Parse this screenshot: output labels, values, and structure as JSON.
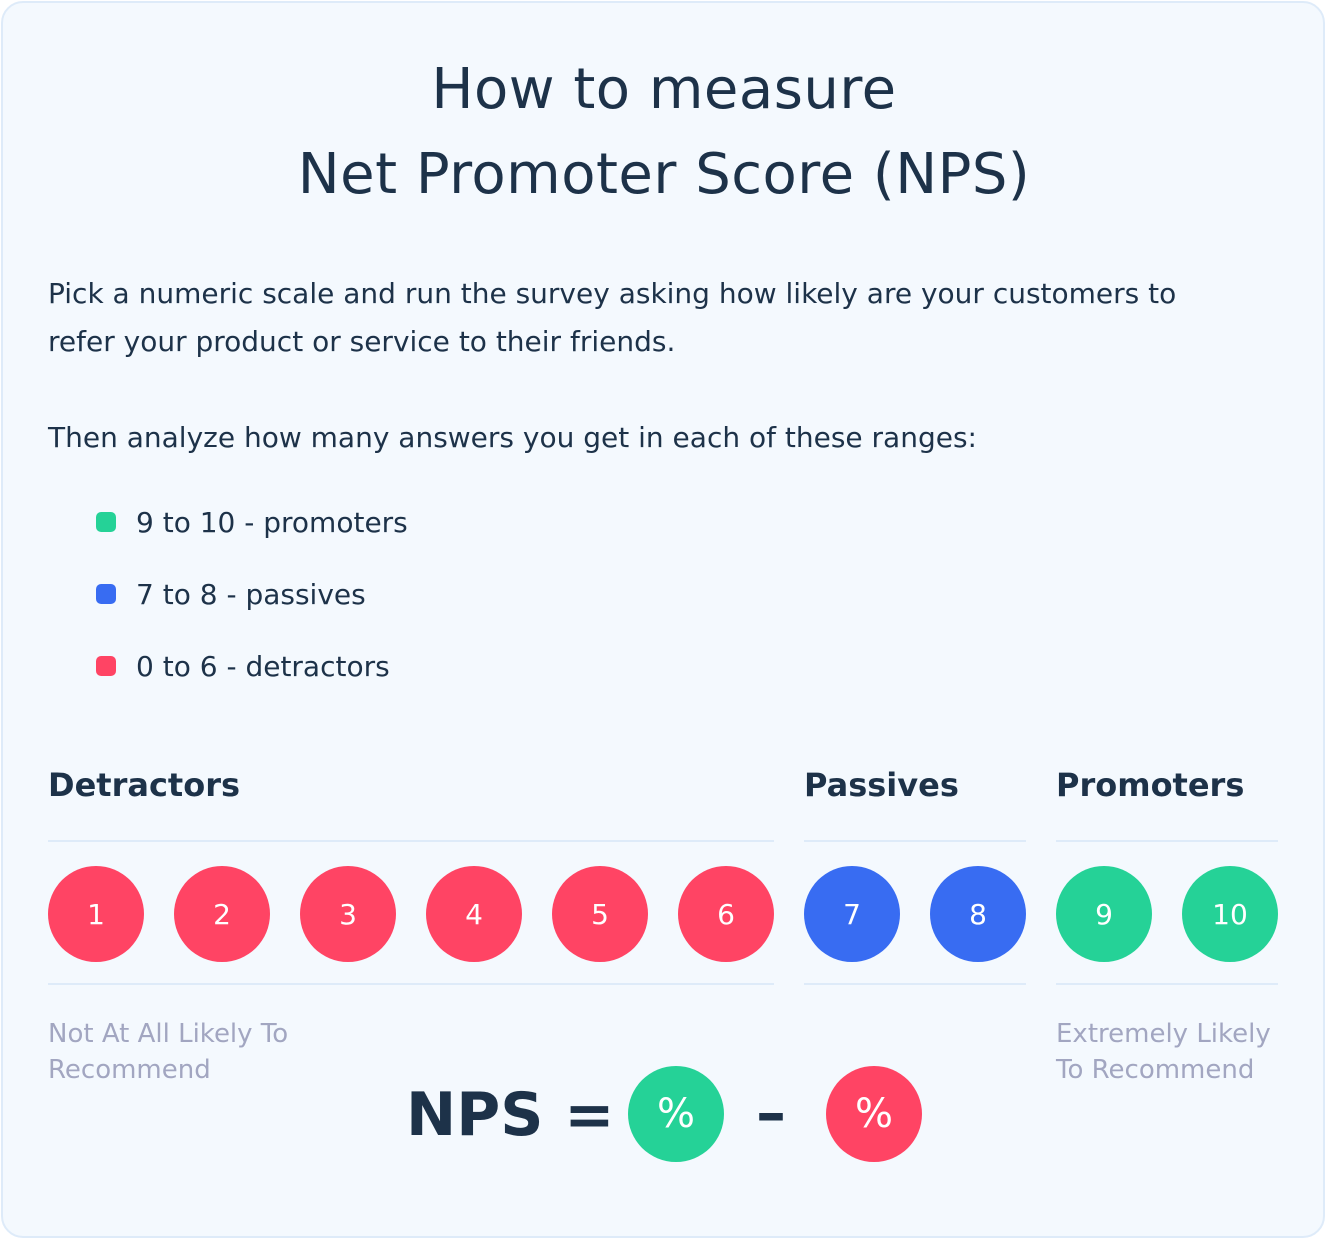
{
  "title": {
    "line1": "How to measure",
    "line2": "Net Promoter Score (NPS)"
  },
  "intro": {
    "paragraph1": "Pick a numeric scale and run the survey asking how likely are your customers to refer your product or service to their friends.",
    "paragraph2": "Then analyze how many answers you get in each of these ranges:"
  },
  "colors": {
    "promoter": "#25d297",
    "passive": "#386cf2",
    "detractor": "#ff4464",
    "text_dark": "#1d3249",
    "text_muted": "#a2a6c1"
  },
  "legend": [
    {
      "label": "9 to 10 - promoters",
      "color": "#25d297"
    },
    {
      "label": "7 to 8 - passives",
      "color": "#386cf2"
    },
    {
      "label": "0 to 6 - detractors",
      "color": "#ff4464"
    }
  ],
  "groups": {
    "detractors": {
      "title": "Detractors",
      "scores": [
        "1",
        "2",
        "3",
        "4",
        "5",
        "6"
      ],
      "color": "#ff4464"
    },
    "passives": {
      "title": "Passives",
      "scores": [
        "7",
        "8"
      ],
      "color": "#386cf2"
    },
    "promoters": {
      "title": "Promoters",
      "scores": [
        "9",
        "10"
      ],
      "color": "#25d297"
    }
  },
  "captions": {
    "left": "Not At All Likely To Recommend",
    "right": "Extremely Likely To Recommend"
  },
  "formula": {
    "label": "NPS =",
    "promoter_symbol": "%",
    "operator": "–",
    "detractor_symbol": "%"
  }
}
